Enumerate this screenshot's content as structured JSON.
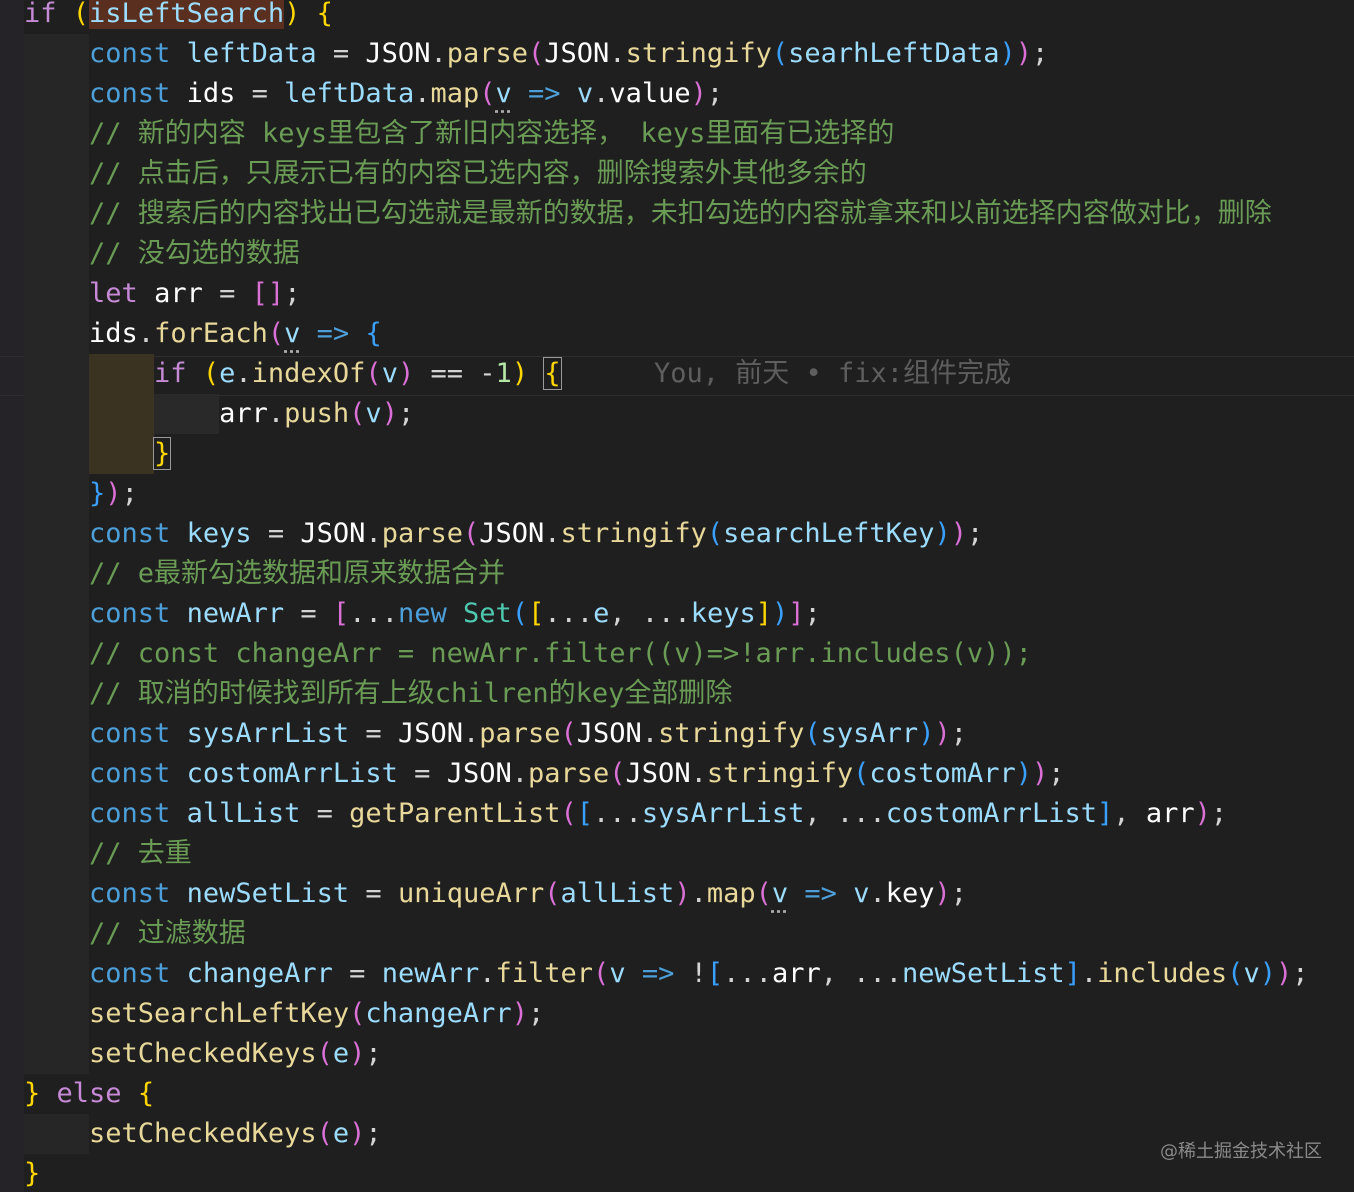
{
  "editor": {
    "language": "javascript",
    "theme": "dark",
    "lines": [
      "if (isLeftSearch) {",
      "    const leftData = JSON.parse(JSON.stringify(searhLeftData));",
      "    const ids = leftData.map(v => v.value);",
      "    // 新的内容 keys里包含了新旧内容选择， keys里面有已选择的",
      "    // 点击后，只展示已有的内容已选内容，删除搜索外其他多余的",
      "    // 搜索后的内容找出已勾选就是最新的数据，未扣勾选的内容就拿来和以前选择内容做对比，删除",
      "    // 没勾选的数据",
      "    let arr = [];",
      "    ids.forEach(v => {",
      "        if (e.indexOf(v) == -1) {",
      "            arr.push(v);",
      "        }",
      "    });",
      "    const keys = JSON.parse(JSON.stringify(searchLeftKey));",
      "    // e最新勾选数据和原来数据合并",
      "    const newArr = [...new Set([...e, ...keys])];",
      "    // const changeArr = newArr.filter((v)=>!arr.includes(v));",
      "    // 取消的时候找到所有上级chilren的key全部删除",
      "    const sysArrList = JSON.parse(JSON.stringify(sysArr));",
      "    const costomArrList = JSON.parse(JSON.stringify(costomArr));",
      "    const allList = getParentList([...sysArrList, ...costomArrList], arr);",
      "    // 去重",
      "    const newSetList = uniqueArr(allList).map(v => v.key);",
      "    // 过滤数据",
      "    const changeArr = newArr.filter(v => ![...arr, ...newSetList].includes(v));",
      "    setSearchLeftKey(changeArr);",
      "    setCheckedKeys(e);",
      "} else {",
      "    setCheckedKeys(e);",
      "}"
    ],
    "blame": "You, 前天 • fix:组件完成"
  },
  "watermark": "@稀土掘金技术社区"
}
